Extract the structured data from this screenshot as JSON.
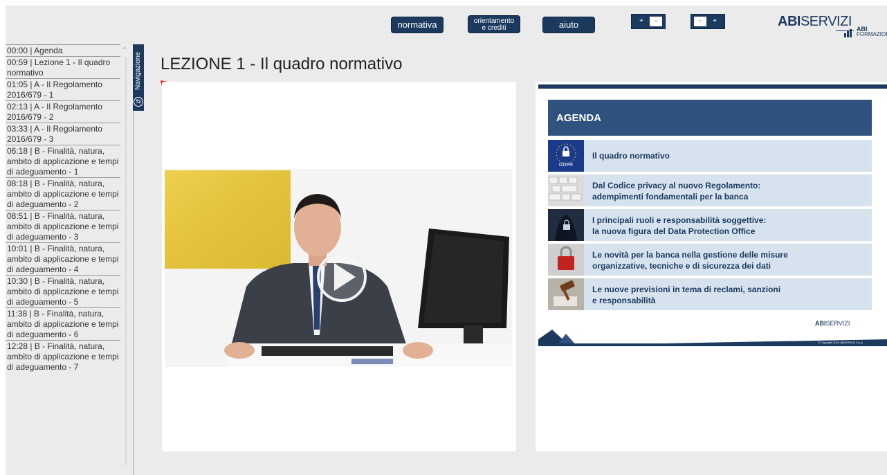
{
  "topbar": {
    "buttons": {
      "normativa": "normativa",
      "orientamento_line1": "orientamento",
      "orientamento_line2": "e crediti",
      "aiuto": "aiuto"
    },
    "zoom_in": {
      "plus": "+",
      "minus": "-"
    },
    "zoom_out": {
      "minus": "-",
      "plus": "+"
    }
  },
  "logo": {
    "abi": "ABI",
    "servizi": "SERVIZI",
    "form_top": "ABI",
    "form_bottom": "FORMAZIONE"
  },
  "sidebar": {
    "items": [
      "00:00 | Agenda",
      "00:59 | Lezione 1 - Il quadro normativo",
      "01:05 | A - Il Regolamento 2016/679 - 1",
      "02:13 | A - Il Regolamento 2016/679 - 2",
      "03:33 | A - Il Regolamento 2016/679 - 3",
      "06:18 | B - Finalità, natura, ambito di applicazione e tempi di adeguamento - 1",
      "08:18 | B - Finalità, natura, ambito di applicazione e tempi di adeguamento - 2",
      "08:51 | B - Finalità, natura, ambito di applicazione e tempi di adeguamento - 3",
      "10:01 | B - Finalità, natura, ambito di applicazione e tempi di adeguamento - 4",
      "10:30 | B - Finalità, natura, ambito di applicazione e tempi di adeguamento - 5",
      "11:38 | B - Finalità, natura, ambito di applicazione e tempi di adeguamento - 6",
      "12:28 | B - Finalità, natura, ambito di applicazione e tempi di adeguamento - 7"
    ],
    "scroll_up": "^"
  },
  "nav_tab": {
    "label": "Navigazione"
  },
  "page_title": "LEZIONE 1 - Il quadro normativo",
  "slide": {
    "heading": "AGENDA",
    "rows": [
      {
        "line1": "Il quadro normativo",
        "line2": "",
        "thumb_label": "GDPR"
      },
      {
        "line1": "Dal Codice privacy al nuovo Regolamento:",
        "line2": "adempimenti fondamentali per la banca",
        "thumb_label": ""
      },
      {
        "line1": "I principali ruoli e responsabilità soggettive:",
        "line2": "la nuova figura del Data Protection Office",
        "thumb_label": ""
      },
      {
        "line1": "Le novità per la banca nella gestione delle misure",
        "line2": "organizzative, tecniche e di sicurezza dei dati",
        "thumb_label": ""
      },
      {
        "line1": "Le nuove previsioni in tema di reclami, sanzioni",
        "line2": "e responsabilità",
        "thumb_label": ""
      }
    ],
    "mini_logo_abi": "ABI",
    "mini_logo_servizi": "SERVIZI",
    "copyright": "© Copyright 2018 ABISERVIZI S.p.A."
  },
  "colors": {
    "accent": "#1c3a5e",
    "agenda_header": "#2f527e",
    "agenda_row": "#d7e2ef",
    "arrow": "#e0201a",
    "background": "#ebebeb"
  }
}
